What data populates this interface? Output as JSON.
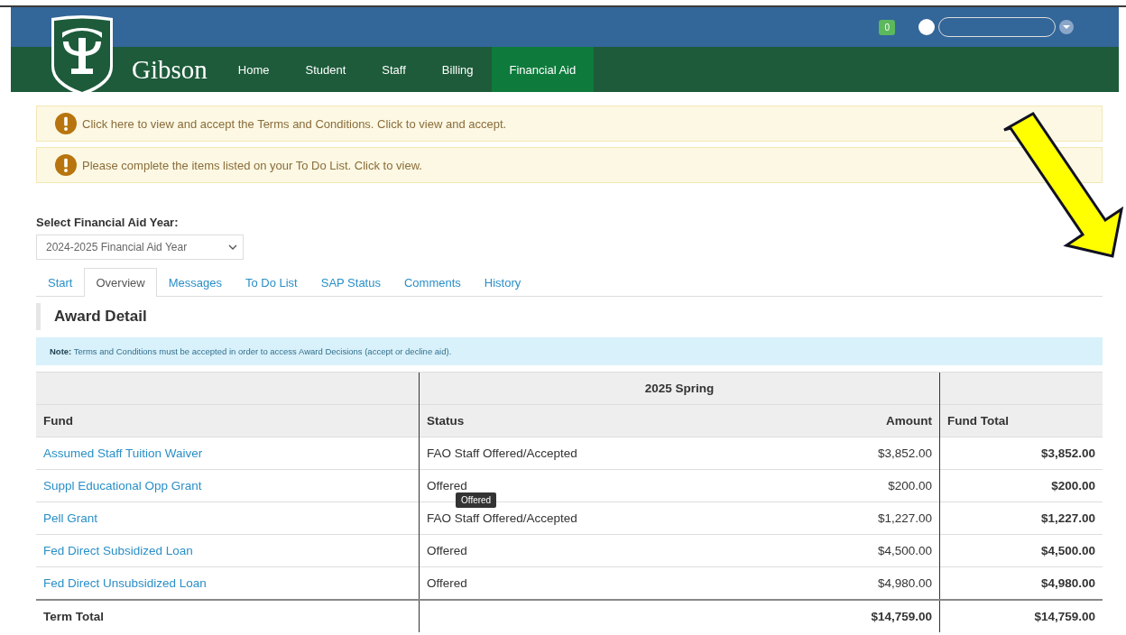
{
  "header": {
    "brand": "Gibson",
    "notification_count": "0",
    "nav": [
      {
        "label": "Home",
        "selected": false
      },
      {
        "label": "Student",
        "selected": false
      },
      {
        "label": "Staff",
        "selected": false
      },
      {
        "label": "Billing",
        "selected": false
      },
      {
        "label": "Financial Aid",
        "selected": true
      }
    ]
  },
  "alerts": [
    {
      "text": "Click here to view and accept the Terms and Conditions. Click to view and accept."
    },
    {
      "text": "Please complete the items listed on your To Do List. Click to view."
    }
  ],
  "year_select": {
    "label": "Select Financial Aid Year:",
    "value": "2024-2025 Financial Aid Year"
  },
  "tabs": [
    {
      "label": "Start",
      "selected": false
    },
    {
      "label": "Overview",
      "selected": true
    },
    {
      "label": "Messages",
      "selected": false
    },
    {
      "label": "To Do List",
      "selected": false
    },
    {
      "label": "SAP Status",
      "selected": false
    },
    {
      "label": "Comments",
      "selected": false
    },
    {
      "label": "History",
      "selected": false
    }
  ],
  "section_title": "Award Detail",
  "note": "**Note:** Terms and Conditions must be accepted in order to access Award Decisions (accept or decline aid).",
  "table": {
    "term": "2025 Spring",
    "columns": [
      "Fund",
      "Status",
      "Amount",
      "Fund Total"
    ],
    "rows": [
      {
        "fund": "Assumed Staff Tuition Waiver",
        "status": "FAO Staff Offered/Accepted",
        "amount": "$3,852.00",
        "fund_total": "$3,852.00"
      },
      {
        "fund": "Suppl Educational Opp Grant",
        "status": "Offered",
        "amount": "$200.00",
        "fund_total": "$200.00",
        "tooltip": "Offered"
      },
      {
        "fund": "Pell Grant",
        "status": "FAO Staff Offered/Accepted",
        "amount": "$1,227.00",
        "fund_total": "$1,227.00"
      },
      {
        "fund": "Fed Direct Subsidized Loan",
        "status": "Offered",
        "amount": "$4,500.00",
        "fund_total": "$4,500.00"
      },
      {
        "fund": "Fed Direct Unsubsidized Loan",
        "status": "Offered",
        "amount": "$4,980.00",
        "fund_total": "$4,980.00"
      }
    ],
    "total": {
      "label": "Term Total",
      "amount": "$14,759.00",
      "fund_total": "$14,759.00"
    }
  }
}
